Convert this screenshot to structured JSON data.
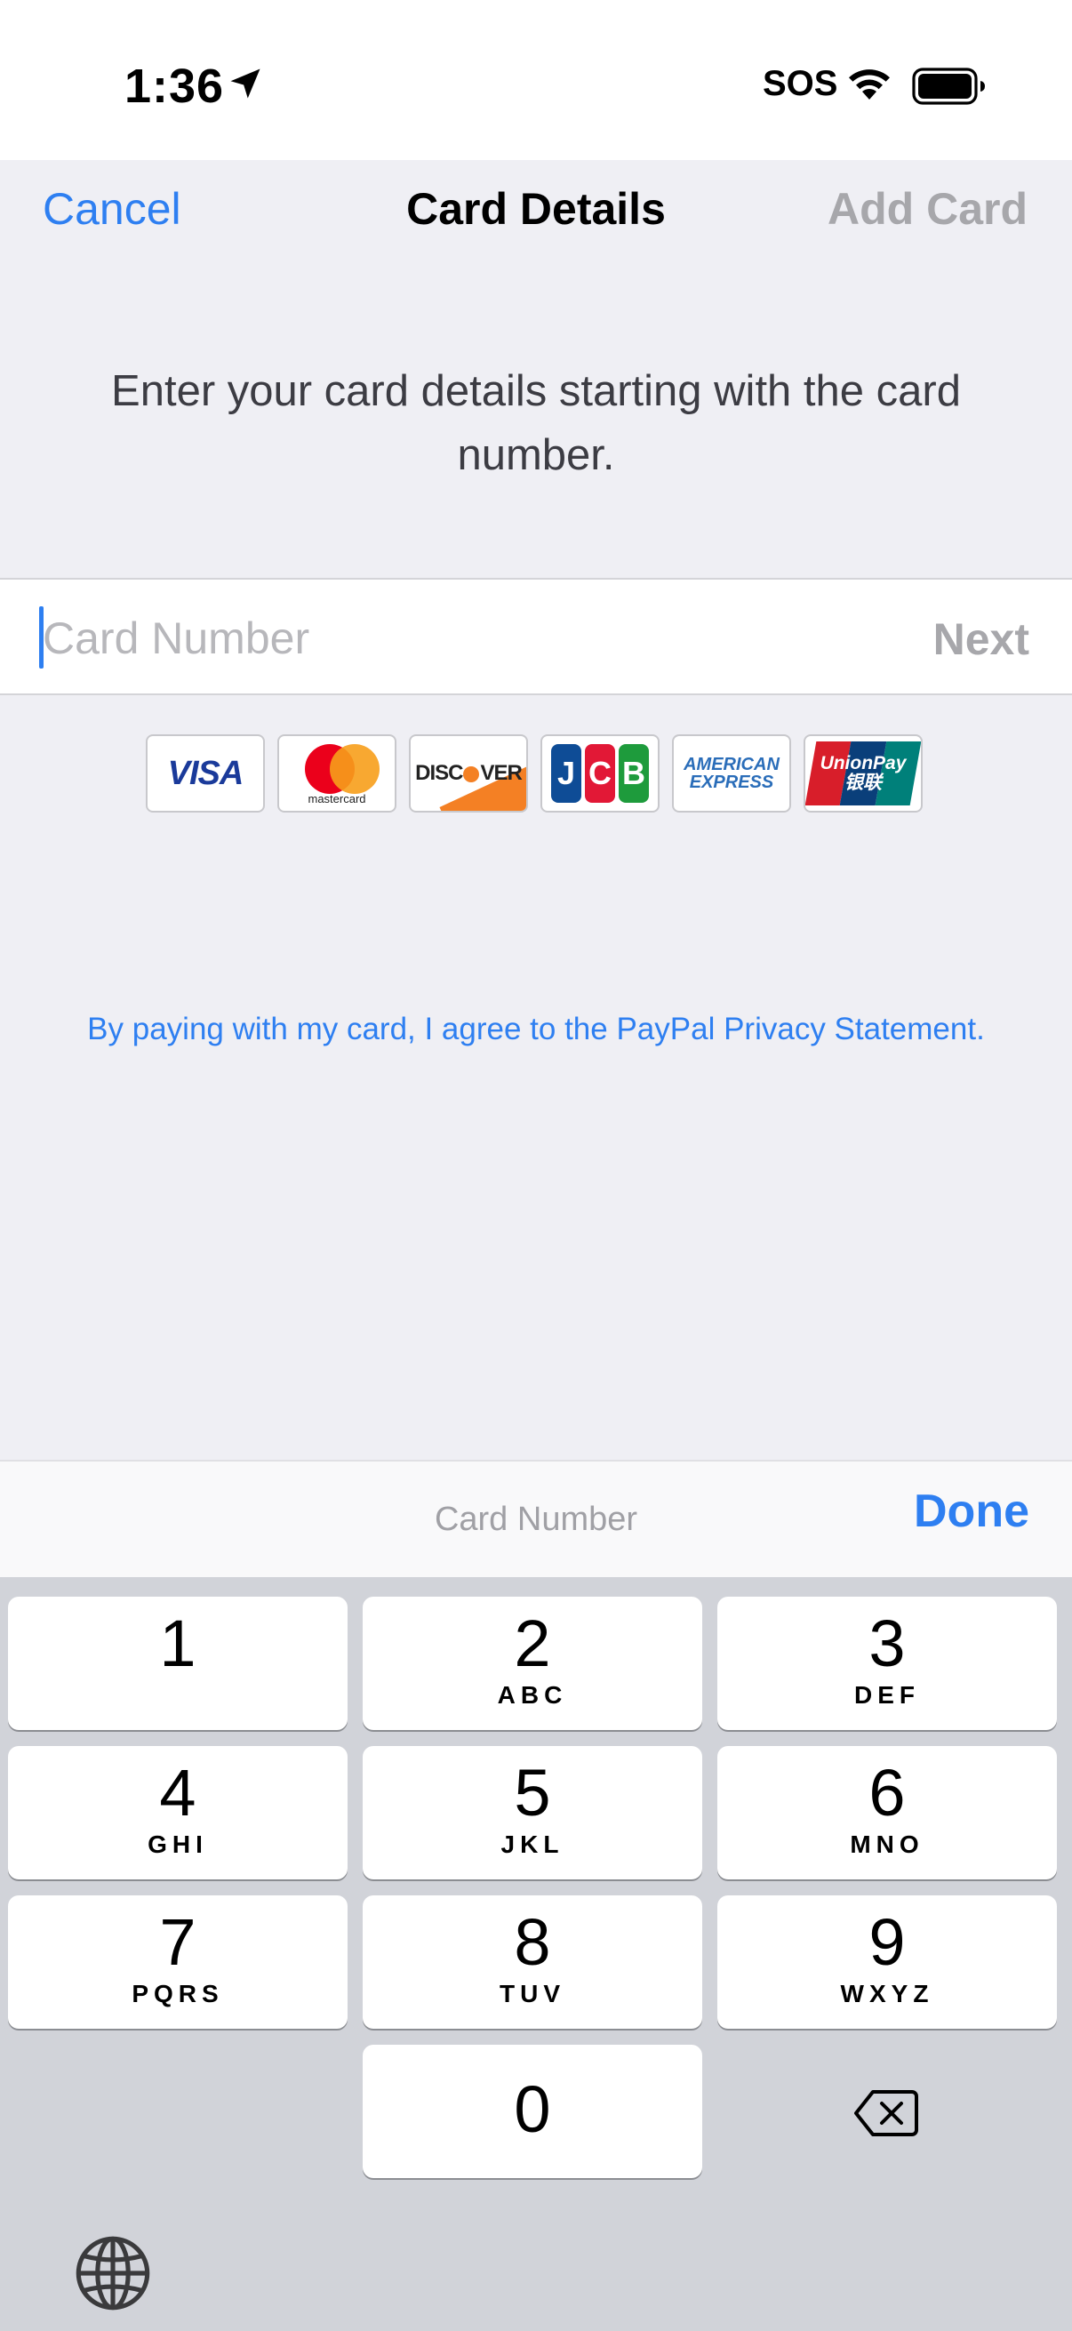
{
  "status_bar": {
    "time": "1:36",
    "sos": "SOS"
  },
  "nav": {
    "cancel": "Cancel",
    "title": "Card Details",
    "add_card": "Add Card"
  },
  "intro_text": "Enter your card details starting with the card number.",
  "card_input": {
    "placeholder": "Card Number",
    "next": "Next"
  },
  "card_logos": {
    "visa": "VISA",
    "mastercard": "mastercard",
    "discover_left": "DISC",
    "discover_right": "VER",
    "jcb": [
      "J",
      "C",
      "B"
    ],
    "amex_line1": "AMERICAN",
    "amex_line2": "EXPRESS",
    "unionpay_line1": "UnionPay",
    "unionpay_line2": "银联"
  },
  "privacy_text": "By paying with my card, I agree to the PayPal Privacy Statement.",
  "accessory": {
    "label": "Card Number",
    "done": "Done"
  },
  "keypad": {
    "keys": [
      {
        "digit": "1",
        "letters": ""
      },
      {
        "digit": "2",
        "letters": "ABC"
      },
      {
        "digit": "3",
        "letters": "DEF"
      },
      {
        "digit": "4",
        "letters": "GHI"
      },
      {
        "digit": "5",
        "letters": "JKL"
      },
      {
        "digit": "6",
        "letters": "MNO"
      },
      {
        "digit": "7",
        "letters": "PQRS"
      },
      {
        "digit": "8",
        "letters": "TUV"
      },
      {
        "digit": "9",
        "letters": "WXYZ"
      },
      {
        "digit": "0",
        "letters": ""
      }
    ]
  },
  "colors": {
    "accent": "#2e7ff1",
    "disabled": "#a7a7ab",
    "background": "#efeff4",
    "keyboard": "#d1d3d9"
  }
}
